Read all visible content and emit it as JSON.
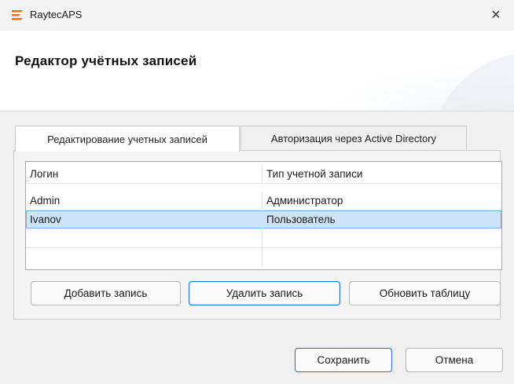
{
  "window": {
    "app_title": "RaytecAPS",
    "close_glyph": "×",
    "brand_color": "#e8731c"
  },
  "header": {
    "title": "Редактор учётных записей"
  },
  "tabs": [
    {
      "label": "Редактирование учетных записей",
      "active": true
    },
    {
      "label": "Авторизация через Active Directory",
      "active": false
    }
  ],
  "grid": {
    "columns": [
      "Логин",
      "Тип учетной записи"
    ],
    "rows": [
      [
        "Admin",
        "Администратор"
      ],
      [
        "Ivanov",
        "Пользователь"
      ],
      [
        "",
        ""
      ],
      [
        "",
        ""
      ]
    ],
    "selected_row": 1
  },
  "actions": {
    "add": "Добавить запись",
    "delete": "Удалить запись",
    "refresh": "Обновить таблицу"
  },
  "footer": {
    "save": "Сохранить",
    "cancel": "Отмена"
  }
}
